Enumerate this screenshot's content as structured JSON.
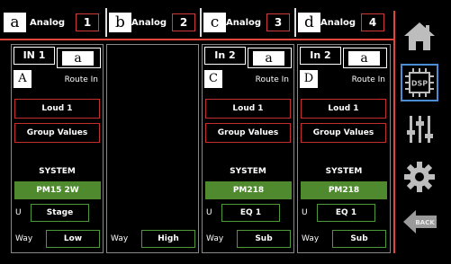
{
  "channels": [
    {
      "letter": "a",
      "source": "Analog",
      "num": "1"
    },
    {
      "letter": "b",
      "source": "Analog",
      "num": "2"
    },
    {
      "letter": "c",
      "source": "Analog",
      "num": "3"
    },
    {
      "letter": "d",
      "source": "Analog",
      "num": "4"
    }
  ],
  "columns": [
    {
      "in_label": "IN 1",
      "input": "a",
      "ch_letter": "A",
      "route": "Route In",
      "preset": "Loud 1",
      "group": "Group Values",
      "system_label": "SYSTEM",
      "system": "PM15 2W",
      "u_label": "U",
      "u_value": "Stage",
      "way_label": "Way",
      "way": "Low"
    },
    {
      "way_label": "Way",
      "way": "High"
    },
    {
      "in_label": "In 2",
      "input": "a",
      "ch_letter": "C",
      "route": "Route In",
      "preset": "Loud 1",
      "group": "Group Values",
      "system_label": "SYSTEM",
      "system": "PM218",
      "u_label": "U",
      "u_value": "EQ 1",
      "way_label": "Way",
      "way": "Sub"
    },
    {
      "in_label": "In 2",
      "input": "a",
      "ch_letter": "D",
      "route": "Route In",
      "preset": "Loud 1",
      "group": "Group Values",
      "system_label": "SYSTEM",
      "system": "PM218",
      "u_label": "U",
      "u_value": "EQ 1",
      "way_label": "Way",
      "way": "Sub"
    }
  ],
  "sidebar": {
    "home_icon": "home-icon",
    "dsp_icon": "dsp-chip-icon",
    "dsp_label": "DSP",
    "mixer_icon": "sliders-icon",
    "settings_icon": "gear-icon",
    "back_icon": "back-arrow-icon",
    "back_label": "BACK"
  },
  "colors": {
    "accent_red": "#e0463a",
    "green": "#4f8a2f",
    "dsp_blue": "#4a8fd6"
  }
}
